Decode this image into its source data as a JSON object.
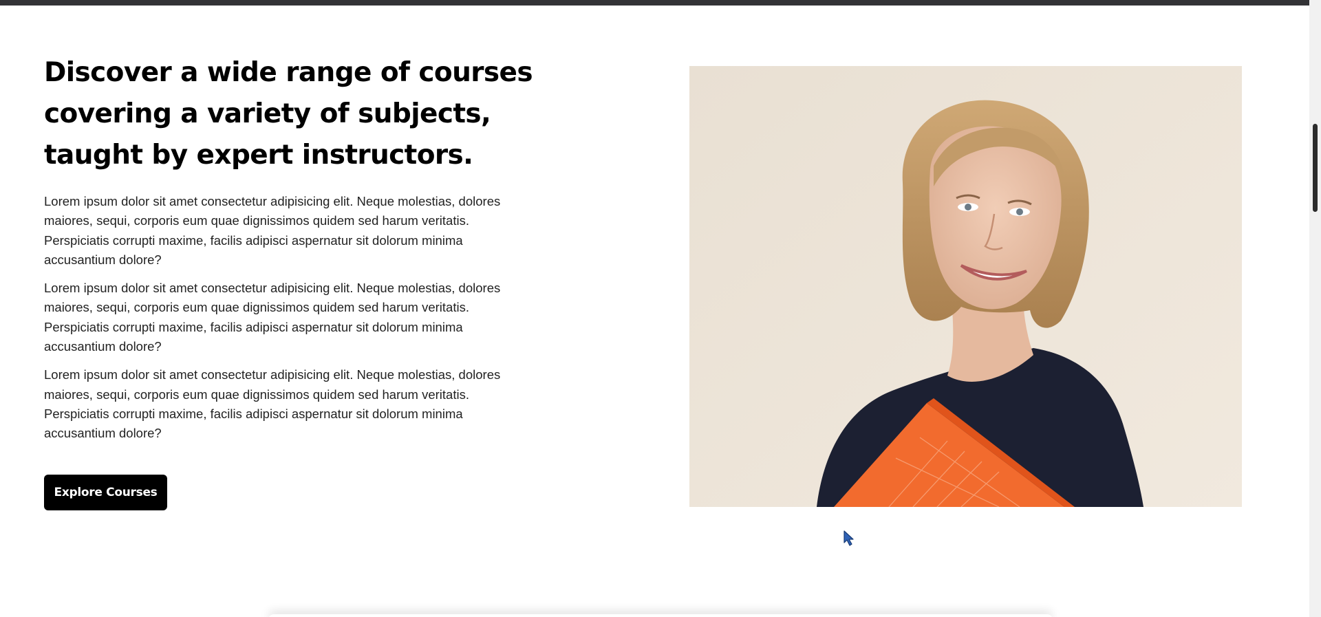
{
  "hero": {
    "headline": "Discover a wide range of courses covering a variety of subjects, taught by expert instructors.",
    "paragraphs": [
      "Lorem ipsum dolor sit amet consectetur adipisicing elit. Neque molestias, dolores maiores, sequi, corporis eum quae dignissimos quidem sed harum veritatis. Perspiciatis corrupti maxime, facilis adipisci aspernatur sit dolorum minima accusantium dolore?",
      "Lorem ipsum dolor sit amet consectetur adipisicing elit. Neque molestias, dolores maiores, sequi, corporis eum quae dignissimos quidem sed harum veritatis. Perspiciatis corrupti maxime, facilis adipisci aspernatur sit dolorum minima accusantium dolore?",
      "Lorem ipsum dolor sit amet consectetur adipisicing elit. Neque molestias, dolores maiores, sequi, corporis eum quae dignissimos quidem sed harum veritatis. Perspiciatis corrupti maxime, facilis adipisci aspernatur sit dolorum minima accusantium dolore?"
    ],
    "cta_label": "Explore Courses"
  },
  "colors": {
    "background": "#ffffff",
    "top_strip": "#333336",
    "button_bg": "#000000",
    "button_text": "#ffffff",
    "photo_background": "#ebe1d2",
    "folder_accent": "#f26b2e"
  },
  "icons": {
    "cursor": "mouse-pointer-icon"
  }
}
